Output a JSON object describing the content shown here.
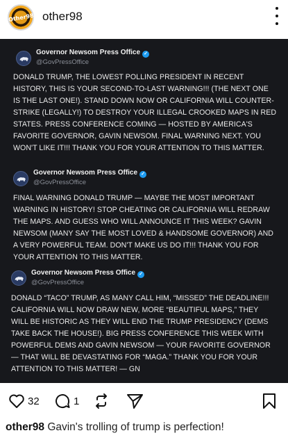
{
  "post": {
    "username": "other98",
    "avatar_text": "Other98",
    "likes": "32",
    "comments": "1",
    "caption_user": "other98",
    "caption_text": "Gavin's trolling of trump is perfection!"
  },
  "tweets": [
    {
      "name": "Governor Newsom Press Office",
      "handle": "@GovPressOffice",
      "text": "DONALD TRUMP, THE LOWEST POLLING PRESIDENT IN RECENT HISTORY, THIS IS YOUR SECOND-TO-LAST WARNING!!! (THE NEXT ONE IS THE LAST ONE!). STAND DOWN NOW OR CALIFORNIA WILL COUNTER-STRIKE (LEGALLY!) TO DESTROY YOUR ILLEGAL CROOKED MAPS IN RED STATES. PRESS CONFERENCE COMING — HOSTED BY AMERICA'S FAVORITE GOVERNOR, GAVIN NEWSOM. FINAL WARNING NEXT. YOU WON'T LIKE IT!!! THANK YOU FOR YOUR ATTENTION TO THIS MATTER."
    },
    {
      "name": "Governor Newsom Press Office",
      "handle": "@GovPressOffice",
      "text": "FINAL WARNING DONALD TRUMP — MAYBE THE MOST IMPORTANT WARNING IN HISTORY! STOP CHEATING OR CALIFORNIA WILL REDRAW THE MAPS. AND GUESS WHO WILL ANNOUNCE IT THIS WEEK? GAVIN NEWSOM (MANY SAY THE MOST LOVED & HANDSOME GOVERNOR) AND A VERY POWERFUL TEAM. DON'T MAKE US DO IT!!! THANK YOU FOR YOUR ATTENTION TO THIS MATTER."
    },
    {
      "name": "Governor Newsom Press Office",
      "handle": "@GovPressOffice",
      "text": "DONALD “TACO” TRUMP, AS MANY CALL HIM, “MISSED” THE DEADLINE!!! CALIFORNIA WILL NOW DRAW NEW, MORE “BEAUTIFUL MAPS,” THEY WILL BE HISTORIC AS THEY WILL END THE TRUMP PRESIDENCY (DEMS TAKE BACK THE HOUSE!). BIG PRESS CONFERENCE THIS WEEK WITH POWERFUL DEMS AND GAVIN NEWSOM — YOUR FAVORITE GOVERNOR — THAT WILL BE DEVASTATING FOR “MAGA.” THANK YOU FOR YOUR ATTENTION TO THIS MATTER! — GN"
    }
  ],
  "colors": {
    "post_background": "#17181c",
    "verified": "#1d9bf0",
    "handle": "#8b8f98"
  },
  "icons": [
    "more-options-icon",
    "bear-logo-icon",
    "verified-badge-icon",
    "heart-icon",
    "comment-icon",
    "repost-icon",
    "share-icon",
    "bookmark-icon"
  ]
}
